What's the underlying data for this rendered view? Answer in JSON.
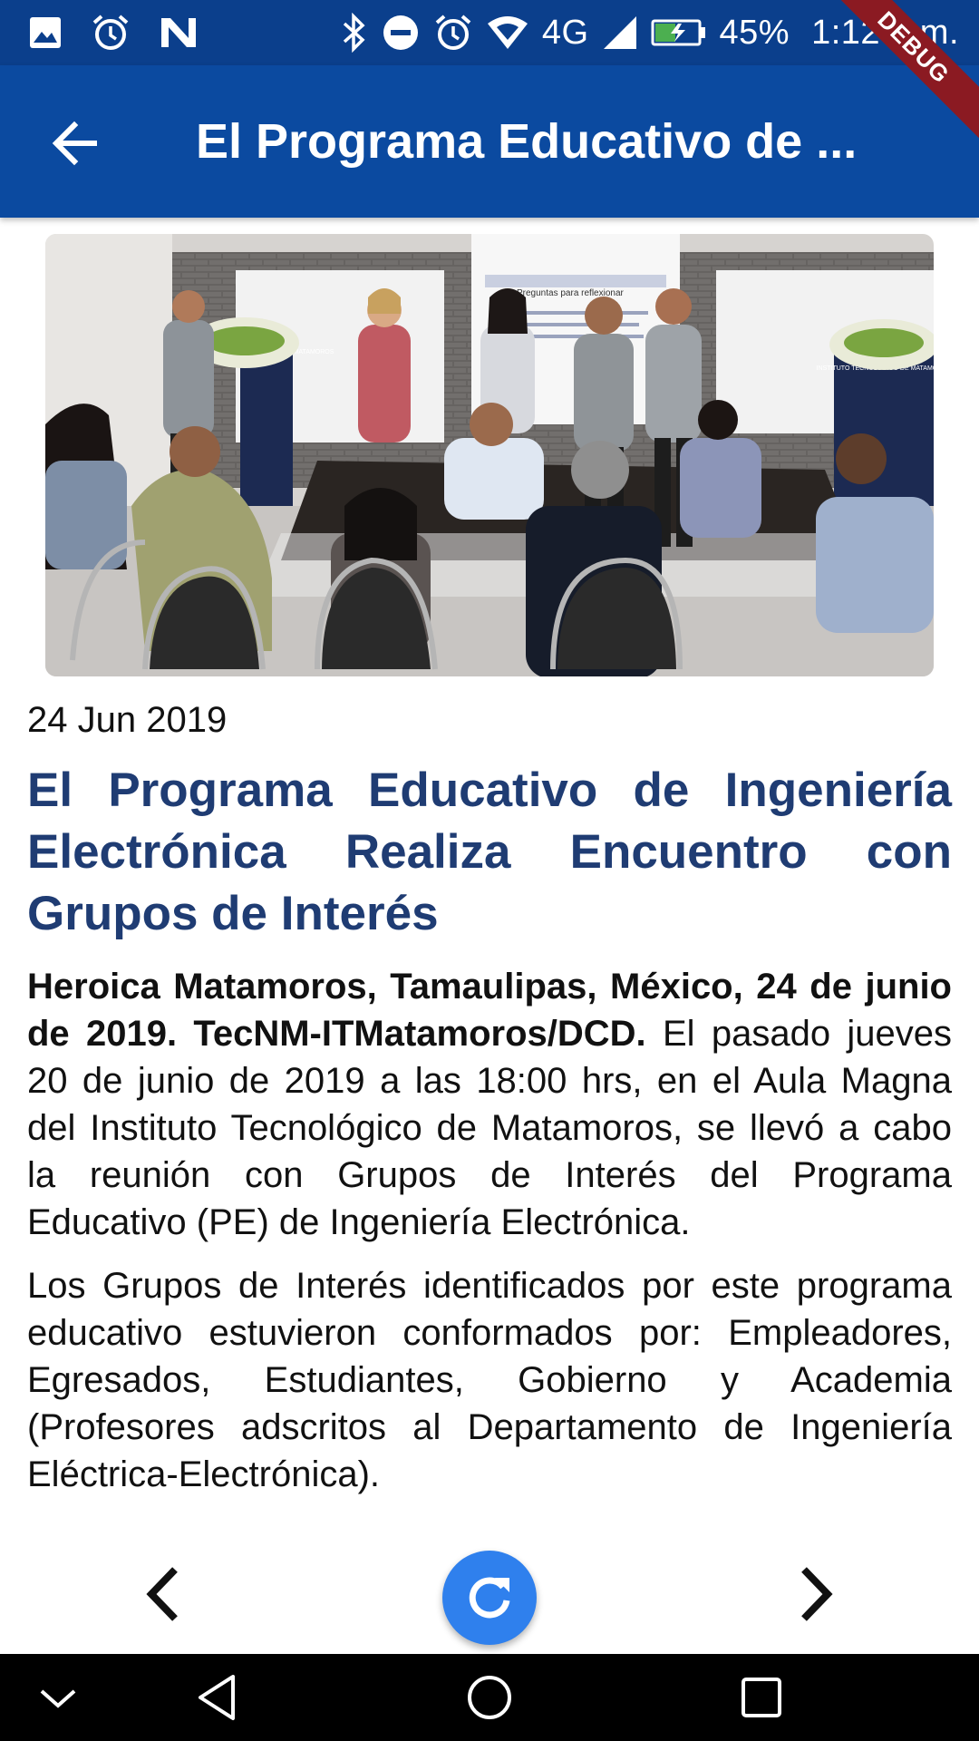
{
  "status_bar": {
    "network": "4G",
    "battery": "45%",
    "time": "1:12 p.m.",
    "debug_banner": "DEBUG",
    "icons": [
      "image-icon",
      "alarm-icon",
      "n-icon",
      "bluetooth-icon",
      "do-not-disturb-icon",
      "alarm-icon",
      "wifi-icon",
      "signal-icon",
      "battery-charging-icon"
    ]
  },
  "app_bar": {
    "title": "El Programa Educativo de ...",
    "back_icon": "arrow-back-icon"
  },
  "article": {
    "date": "24 Jun 2019",
    "title": "El Programa Educativo de Ingeniería Electrónica Realiza Encuentro con Grupos de Interés",
    "lead_bold": "Heroica Matamoros, Tamaulipas, México, 24 de junio de 2019. TecNM-ITMatamoros/DCD.",
    "paragraph_1_rest": " El pasado jueves 20 de junio de 2019 a las 18:00 hrs, en el Aula Magna del Instituto Tecnológico de Matamoros, se llevó a cabo la reunión con Grupos de Interés del Programa Educativo (PE) de Ingeniería Electrónica.",
    "paragraph_2": "Los Grupos de Interés identificados por este programa educativo estuvieron conformados por: Empleadores, Egresados, Estudiantes, Gobierno y Academia (Profesores adscritos al Departamento de Ingeniería Eléctrica-Electrónica).",
    "image": {
      "screen_heading": "Preguntas para reflexionar",
      "banner_left": "INSTITUTO TECNOLÓGICO DE MATAMOROS",
      "banner_right": "INSTITUTO TECNOLÓGICO DE MATAMOROS"
    }
  },
  "pager": {
    "prev_icon": "chevron-left-icon",
    "refresh_icon": "refresh-icon",
    "next_icon": "chevron-right-icon"
  },
  "nav_bar": {
    "icons": [
      "chevron-down-icon",
      "back-triangle-icon",
      "home-circle-icon",
      "recents-square-icon"
    ]
  },
  "colors": {
    "status_bar": "#0b3f8c",
    "app_bar": "#0b4aa0",
    "title_text": "#1f3c73",
    "fab": "#2f80ed",
    "debug_ribbon": "#8b1a22"
  }
}
